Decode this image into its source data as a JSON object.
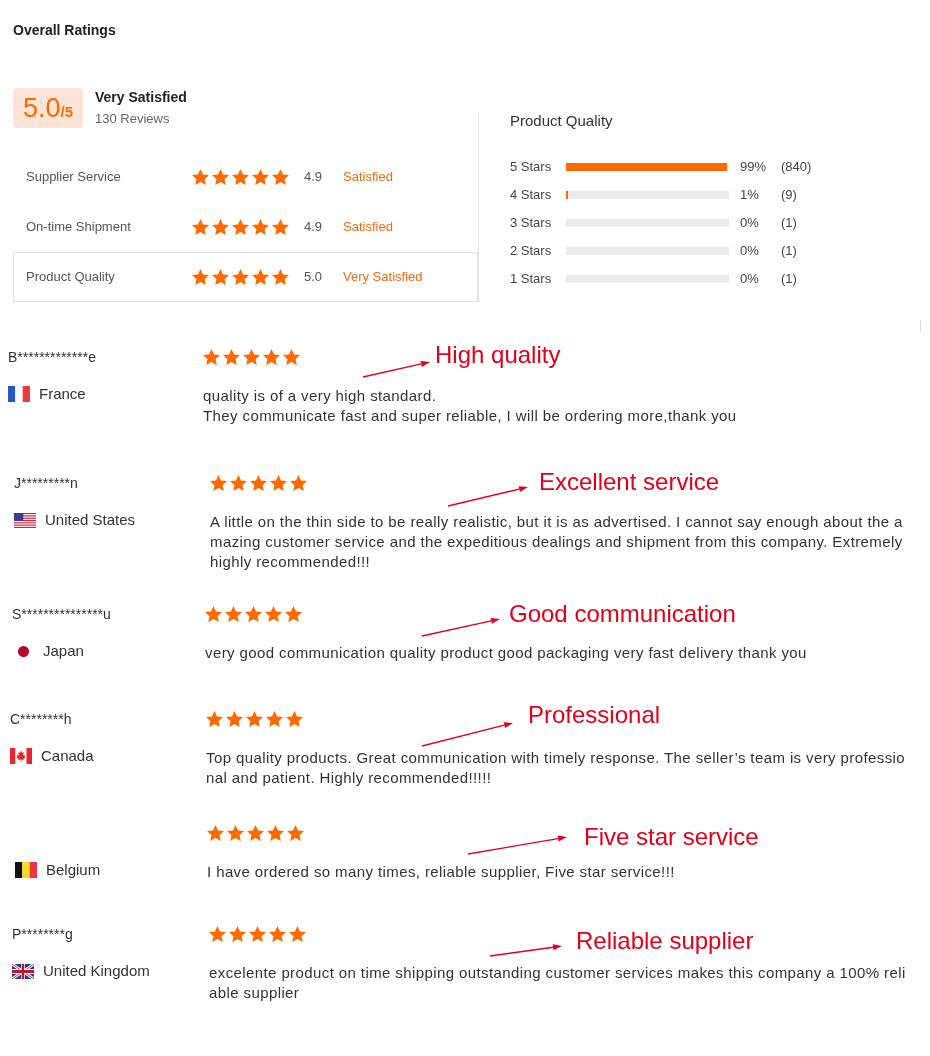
{
  "title": "Overall Ratings",
  "summary": {
    "score": "5.0",
    "out_of": "/5",
    "verdict": "Very Satisfied",
    "reviews": "130 Reviews"
  },
  "ratings": [
    {
      "label": "Supplier Service",
      "stars": 5,
      "value": "4.9",
      "verdict": "Satisfied",
      "selected": false
    },
    {
      "label": "On-time Shipment",
      "stars": 5,
      "value": "4.9",
      "verdict": "Satisfied",
      "selected": false
    },
    {
      "label": "Product Quality",
      "stars": 5,
      "value": "5.0",
      "verdict": "Very Satisfied",
      "selected": true
    }
  ],
  "breakdown": {
    "title": "Product Quality",
    "rows": [
      {
        "label": "5 Stars",
        "level": 0.99,
        "percent": "99%",
        "count": "(840)"
      },
      {
        "label": "4 Stars",
        "level": 0.01,
        "percent": "1%",
        "count": "(9)"
      },
      {
        "label": "3 Stars",
        "level": 0,
        "percent": "0%",
        "count": "(1)"
      },
      {
        "label": "2 Stars",
        "level": 0,
        "percent": "0%",
        "count": "(1)"
      },
      {
        "label": "1 Stars",
        "level": 0,
        "percent": "0%",
        "count": "(1)"
      }
    ]
  },
  "reviews": [
    {
      "name": "B*************e",
      "country": "France",
      "stars": 5,
      "tag": "High quality",
      "text": "quality is of a very high standard.\nThey communicate fast and super reliable, I will be ordering more,thank you"
    },
    {
      "name": "J*********n",
      "country": "United States",
      "stars": 5,
      "tag": "Excellent service",
      "text": "A little on the thin side to be really realistic, but it is as advertised. I cannot say enough about the amazing customer service and the expeditious dealings and shipment from this company. Extremely highly recommended!!!"
    },
    {
      "name": "S***************u",
      "country": "Japan",
      "stars": 5,
      "tag": "Good communication",
      "text": "very good communication quality product good packaging very fast delivery thank you"
    },
    {
      "name": "C********h",
      "country": "Canada",
      "stars": 5,
      "tag": "Professional",
      "text": "Top quality products. Great communication with timely response. The seller’s team is very professional and patient. Highly recommended!!!!!"
    },
    {
      "country": "Belgium",
      "stars": 5,
      "tag": "Five star service",
      "text": "I have ordered so many times, reliable supplier, Five star service!!!"
    },
    {
      "name": "P********g",
      "country": "United Kingdom",
      "stars": 5,
      "tag": "Reliable supplier",
      "text": "excelente product on time shipping outstanding customer services makes this company a 100% reliable supplier"
    }
  ]
}
